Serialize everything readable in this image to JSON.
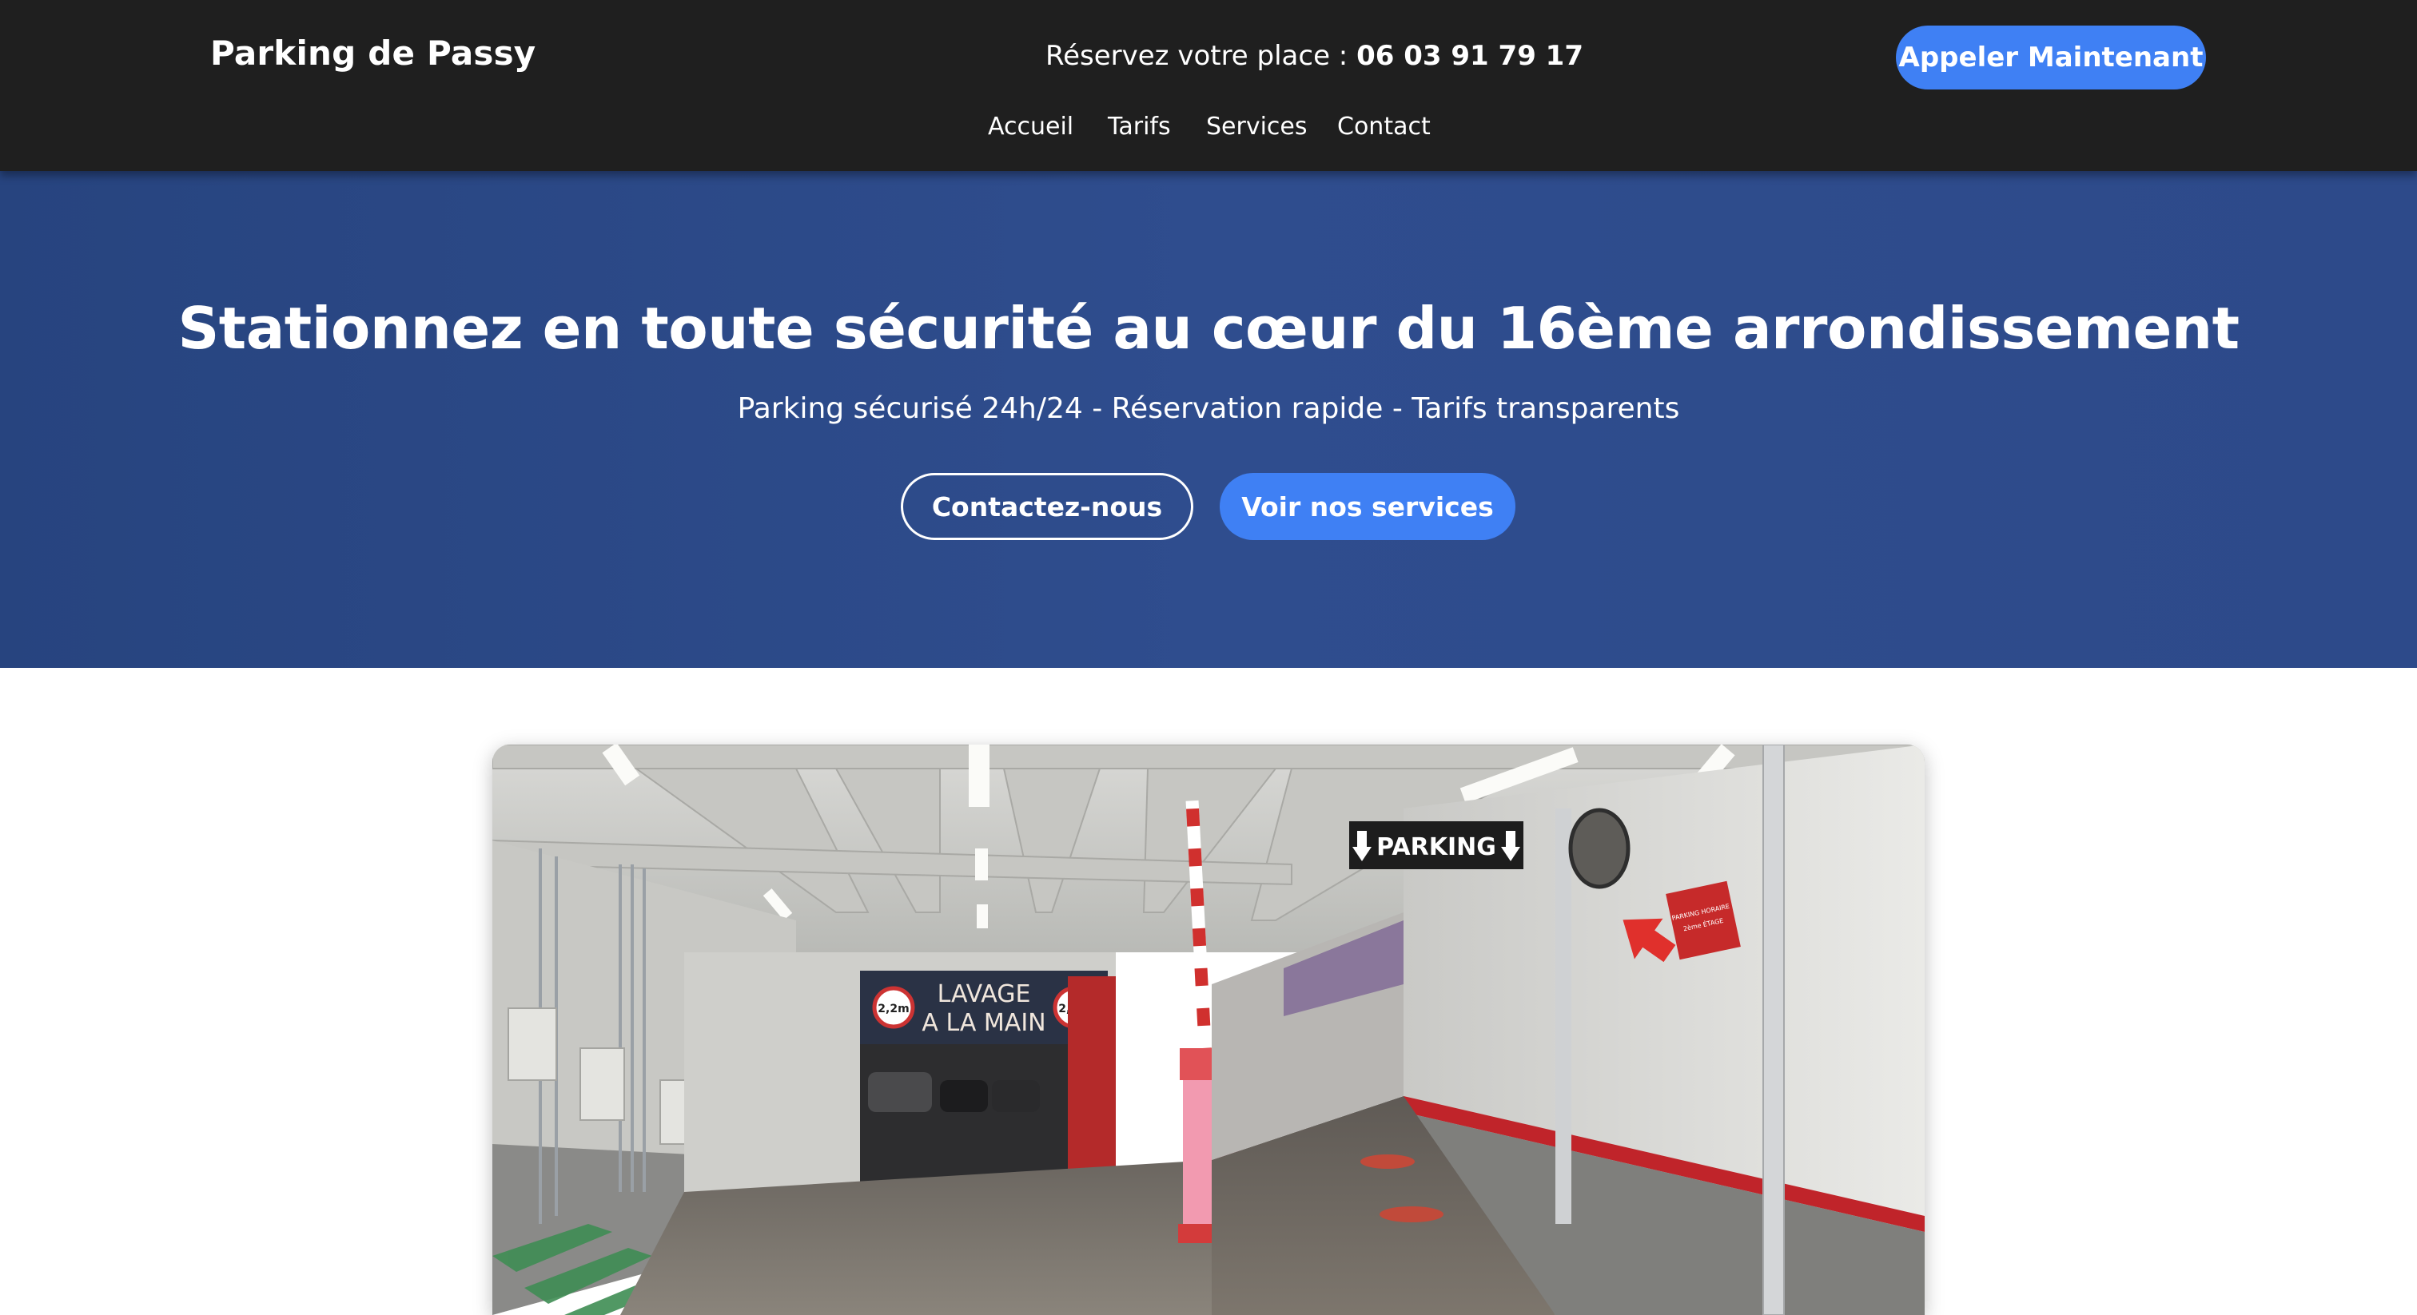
{
  "header": {
    "brand": "Parking de Passy",
    "reserve_text": "Réservez votre place : ",
    "phone": "06 03 91 79 17",
    "call_button": "Appeler Maintenant",
    "nav": [
      "Accueil",
      "Tarifs",
      "Services",
      "Contact"
    ]
  },
  "hero": {
    "title": "Stationnez en toute sécurité au cœur du 16ème arrondissement",
    "subtitle": "Parking sécurisé 24h/24 - Réservation rapide - Tarifs transparents",
    "primary_button": "Contactez-nous",
    "secondary_button": "Voir nos services"
  },
  "photo": {
    "sign_parking": "PARKING",
    "sign_lavage_line1": "LAVAGE",
    "sign_lavage_line2": "A LA MAIN",
    "height_badge": "2,2m",
    "red_sign_line1": "PARKING HORAIRE",
    "red_sign_line2": "2ème ÉTAGE"
  },
  "colors": {
    "header_bg": "#1f1f1f",
    "hero_bg": "#2f4d8e",
    "accent": "#3f80f4"
  }
}
